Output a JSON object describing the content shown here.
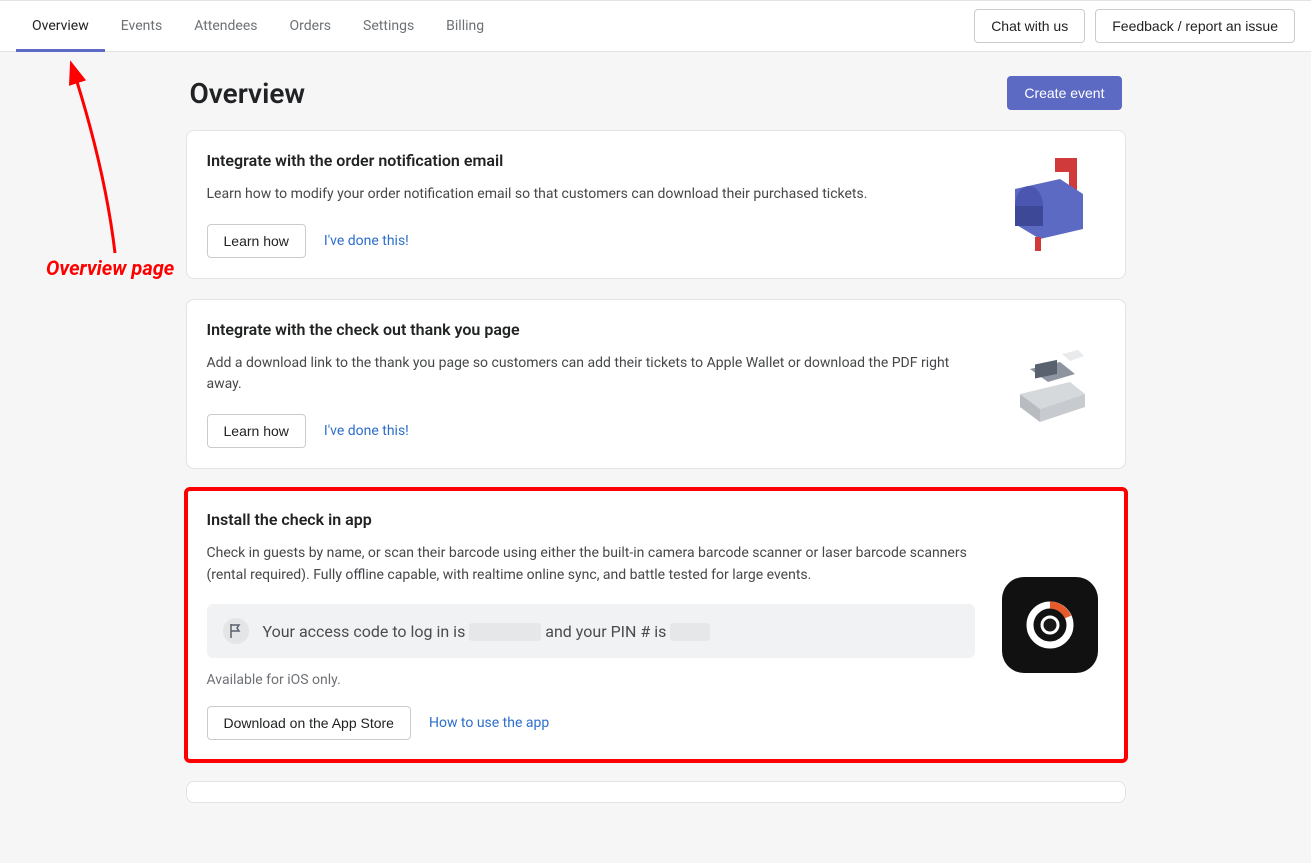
{
  "nav": {
    "tabs": [
      "Overview",
      "Events",
      "Attendees",
      "Orders",
      "Settings",
      "Billing"
    ],
    "chat": "Chat with us",
    "feedback": "Feedback / report an issue"
  },
  "page": {
    "title": "Overview",
    "create_event": "Create event"
  },
  "cards": {
    "c1": {
      "title": "Integrate with the order notification email",
      "desc": "Learn how to modify your order notification email so that customers can download their purchased tickets.",
      "learn": "Learn how",
      "done": "I've done this!"
    },
    "c2": {
      "title": "Integrate with the check out thank you page",
      "desc": "Add a download link to the thank you page so customers can add their tickets to Apple Wallet or download the PDF right away.",
      "learn": "Learn how",
      "done": "I've done this!"
    },
    "c3": {
      "title": "Install the check in app",
      "desc": "Check in guests by name, or scan their barcode using either the built-in camera barcode scanner or laser barcode scanners (rental required). Fully offline capable, with realtime online sync, and battle tested for large events.",
      "banner_pre": "Your access code to log in is ",
      "banner_mid": " and your PIN # is ",
      "note": "Available for iOS only.",
      "download": "Download on the App Store",
      "howto": "How to use the app"
    }
  },
  "annotation": {
    "label": "Overview page"
  }
}
